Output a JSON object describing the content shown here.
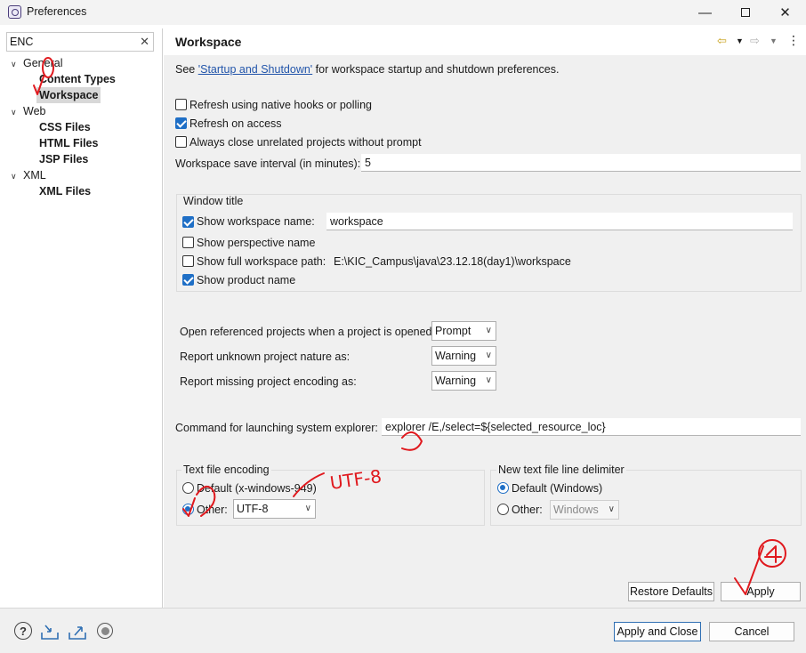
{
  "window": {
    "title": "Preferences"
  },
  "filter": {
    "value": "ENC"
  },
  "tree": {
    "general": "General",
    "content_types": "Content Types",
    "workspace": "Workspace",
    "web": "Web",
    "css_files": "CSS Files",
    "html_files": "HTML Files",
    "jsp_files": "JSP Files",
    "xml": "XML",
    "xml_files": "XML Files"
  },
  "page": {
    "title": "Workspace",
    "intro_prefix": "See ",
    "intro_link": "'Startup and Shutdown'",
    "intro_suffix": " for workspace startup and shutdown preferences.",
    "refresh_native": "Refresh using native hooks or polling",
    "refresh_access": "Refresh on access",
    "always_close": "Always close unrelated projects without prompt",
    "save_interval_label": "Workspace save interval (in minutes):",
    "save_interval_value": "5"
  },
  "window_title_group": {
    "title": "Window title",
    "show_ws_name": "Show workspace name:",
    "ws_name_value": "workspace",
    "show_perspective": "Show perspective name",
    "show_full_path": "Show full workspace path:",
    "full_path_value": "E:\\KIC_Campus\\java\\23.12.18(day1)\\workspace",
    "show_product": "Show product name"
  },
  "projects": {
    "open_ref_label": "Open referenced projects when a project is opened:",
    "open_ref_value": "Prompt",
    "unknown_nature_label": "Report unknown project nature as:",
    "unknown_nature_value": "Warning",
    "missing_encoding_label": "Report missing project encoding as:",
    "missing_encoding_value": "Warning"
  },
  "explorer": {
    "label": "Command for launching system explorer:",
    "value": "explorer /E,/select=${selected_resource_loc}"
  },
  "encoding": {
    "title": "Text file encoding",
    "default_label": "Default (x-windows-949)",
    "other_label": "Other:",
    "other_value": "UTF-8"
  },
  "line_delimiter": {
    "title": "New text file line delimiter",
    "default_label": "Default (Windows)",
    "other_label": "Other:",
    "other_value": "Windows"
  },
  "buttons": {
    "restore_defaults": "Restore Defaults",
    "apply": "Apply",
    "apply_close": "Apply and Close",
    "cancel": "Cancel"
  },
  "annotations": {
    "utf8_note": "UTF-8"
  },
  "colors": {
    "accent": "#1f6fc6",
    "link": "#2255aa",
    "annotation_red": "#e0191e",
    "pane_background": "#f0f0f0"
  }
}
